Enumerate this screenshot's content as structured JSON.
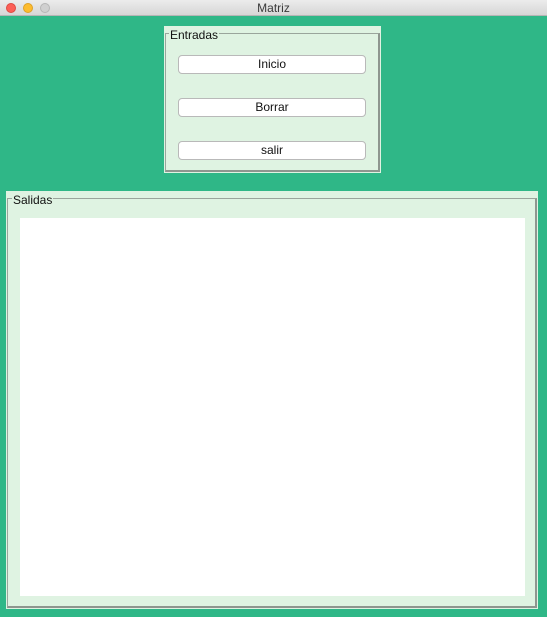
{
  "window": {
    "title": "Matriz",
    "background_color": "#2fb787"
  },
  "entradas": {
    "legend": "Entradas",
    "buttons": {
      "inicio": "Inicio",
      "borrar": "Borrar",
      "salir": "salir"
    }
  },
  "salidas": {
    "legend": "Salidas",
    "output_value": ""
  }
}
